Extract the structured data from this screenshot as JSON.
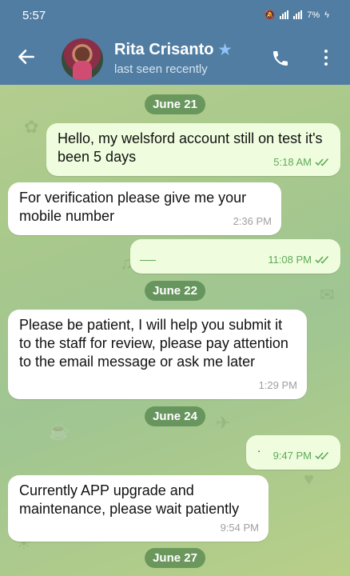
{
  "status_bar": {
    "time": "5:57",
    "battery": "7%"
  },
  "header": {
    "contact_name": "Rita Crisanto",
    "status": "last seen recently"
  },
  "messages": [
    {
      "type": "date",
      "text": "June 21"
    },
    {
      "type": "out",
      "text": "Hello, my welsford account still on test it's been 5 days",
      "time": "5:18 AM"
    },
    {
      "type": "in",
      "text": "For verification please give me your mobile number",
      "time": "2:36 PM"
    },
    {
      "type": "out",
      "text": "",
      "time": "11:08 PM"
    },
    {
      "type": "date",
      "text": "June 22"
    },
    {
      "type": "in",
      "text": "Please be patient, I will help you submit it to the staff for review, please pay attention to the email message or ask me later",
      "time": "1:29 PM"
    },
    {
      "type": "date",
      "text": "June 24"
    },
    {
      "type": "out",
      "text": "·",
      "time": "9:47 PM"
    },
    {
      "type": "in",
      "text": "Currently APP upgrade and maintenance, please wait patiently",
      "time": "9:54 PM"
    },
    {
      "type": "date",
      "text": "June 27"
    }
  ],
  "colors": {
    "header": "#517da2",
    "outgoing": "#effdde",
    "incoming": "#ffffff",
    "date_chip": "#5b8a52",
    "check": "#5eaa58"
  },
  "icons": [
    "back-arrow-icon",
    "star-icon",
    "phone-icon",
    "more-vert-icon",
    "double-check-icon"
  ]
}
